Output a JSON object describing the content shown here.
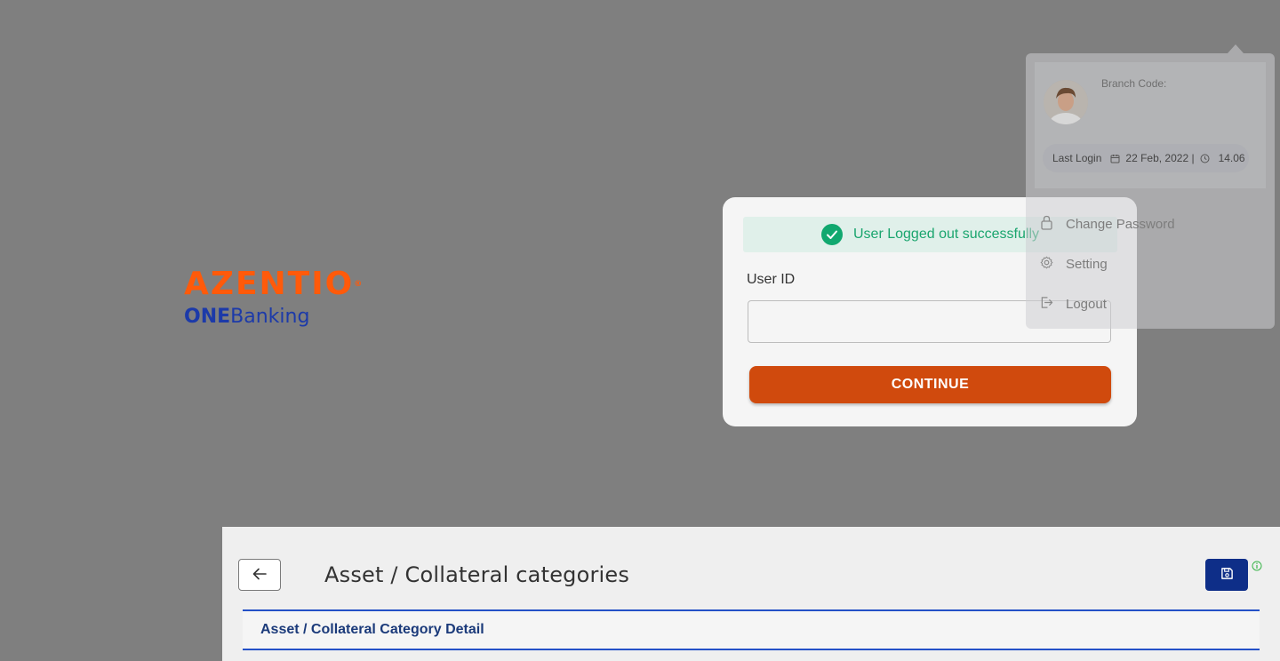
{
  "brand": {
    "name": "AZENTIO",
    "trademark": "®",
    "sub_bold": "ONE",
    "sub_rest": "Banking"
  },
  "login": {
    "toast_text": "User Logged out successfully",
    "user_id_label": "User ID",
    "user_id_value": "",
    "continue_label": "CONTINUE"
  },
  "profile": {
    "branch_label": "Branch Code:",
    "last_login_label": "Last Login",
    "last_login_date": "22 Feb, 2022 |",
    "last_login_time": "14.06",
    "menu": [
      {
        "label": "Change Password",
        "icon": "lock-icon"
      },
      {
        "label": "Setting",
        "icon": "gear-icon"
      },
      {
        "label": "Logout",
        "icon": "logout-icon"
      }
    ]
  },
  "page": {
    "title": "Asset / Collateral categories",
    "section_title": "Asset / Collateral Category Detail"
  },
  "colors": {
    "overlay": "#7f7f7f",
    "brand_orange": "#ff5a0a",
    "brand_blue": "#1c3aa9",
    "continue_button": "#d04a0d",
    "success_green": "#1aa56e",
    "save_button": "#0e2e88",
    "section_border": "#2451c7"
  }
}
